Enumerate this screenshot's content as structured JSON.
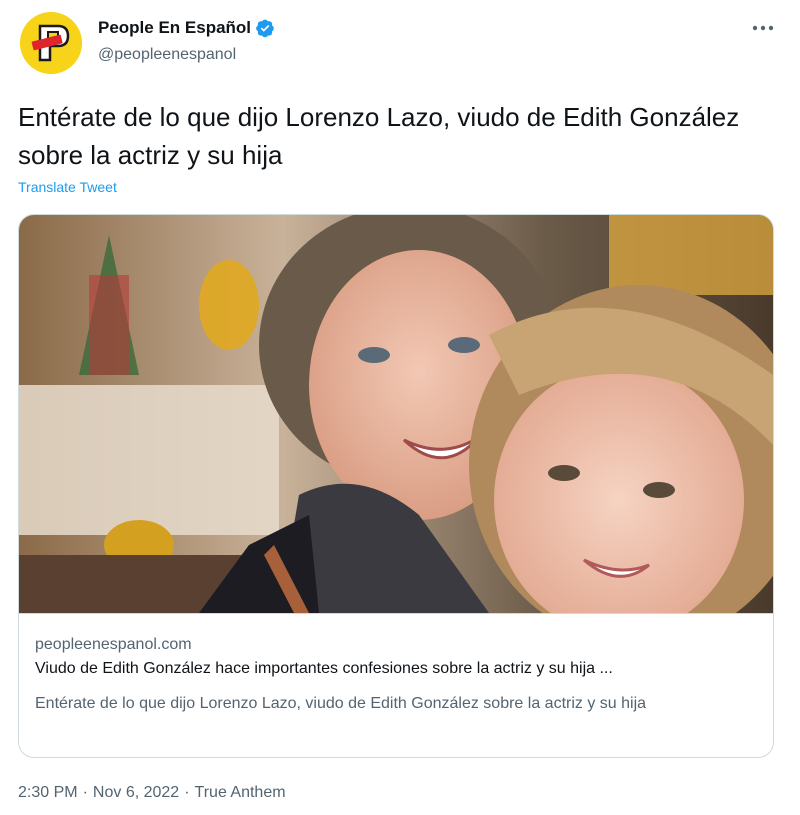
{
  "author": {
    "display_name": "People En Español",
    "handle": "@peopleenespanol",
    "avatar_icon": "people-en-espanol-logo-icon",
    "verified_icon": "verified-badge-icon",
    "verified_color": "#1d9bf0"
  },
  "menu": {
    "more_icon": "more-options-icon"
  },
  "tweet": {
    "text": "Entérate de lo que dijo Lorenzo Lazo, viudo de Edith González sobre la actriz y su hija",
    "translate_label": "Translate Tweet"
  },
  "card": {
    "image_icon": "article-photo-image",
    "domain": "peopleenespanol.com",
    "title": "Viudo de Edith González hace importantes confesiones sobre la actriz y su hija ...",
    "description": "Entérate de lo que dijo Lorenzo Lazo, viudo de Edith González sobre la actriz y su hija"
  },
  "meta": {
    "time": "2:30 PM",
    "separator": "·",
    "date": "Nov 6, 2022",
    "source": "True Anthem"
  },
  "colors": {
    "link": "#1d9bf0",
    "secondary_text": "#536471",
    "primary_text": "#0f1419",
    "border": "#cfd9de",
    "avatar_bg": "#f7d31a"
  }
}
